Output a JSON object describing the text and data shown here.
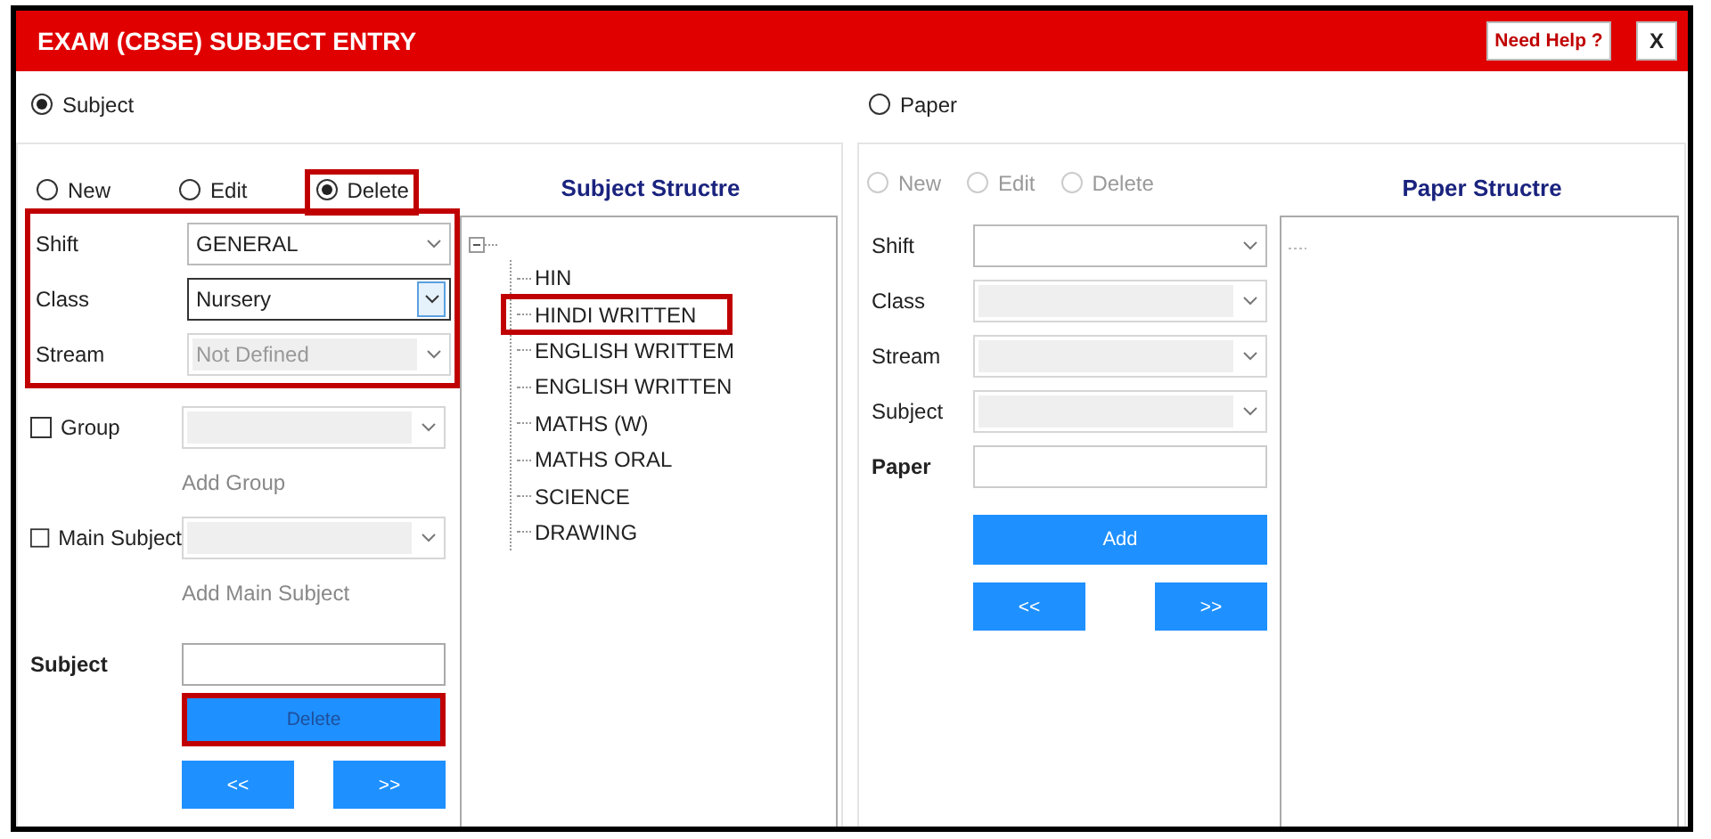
{
  "window": {
    "title": "EXAM (CBSE) SUBJECT ENTRY",
    "buttons": [
      "Need Help ?",
      "X"
    ]
  },
  "sections": [
    {
      "label": "Subject",
      "selected": true
    },
    {
      "label": "Paper",
      "selected": false
    }
  ],
  "subject_panel": {
    "modes": [
      {
        "label": "New",
        "selected": false,
        "disabled": false,
        "highlighted": false
      },
      {
        "label": "Edit",
        "selected": false,
        "disabled": false,
        "highlighted": false
      },
      {
        "label": "Delete",
        "selected": true,
        "disabled": false,
        "highlighted": true
      }
    ],
    "filters": {
      "highlighted": true,
      "fields": [
        {
          "label": "Shift",
          "value": "GENERAL",
          "disabled": false,
          "focused": false
        },
        {
          "label": "Class",
          "value": "Nursery",
          "disabled": false,
          "focused": true
        },
        {
          "label": "Stream",
          "value": "Not Defined",
          "disabled": true,
          "focused": false
        }
      ]
    },
    "options": [
      {
        "label": "Group",
        "checked": false,
        "disabled": true,
        "link": "Add Group"
      },
      {
        "label": "Main Subject",
        "checked": false,
        "disabled": true,
        "link": "Add Main Subject"
      }
    ],
    "name_field": {
      "label": "Subject"
    },
    "action": {
      "label": "Delete",
      "highlighted": true
    },
    "nav": [
      "<<",
      ">>"
    ],
    "structure": {
      "title": "Subject Structre",
      "expanded": true,
      "items": [
        {
          "label": "HIN",
          "highlighted": false
        },
        {
          "label": "HINDI WRITTEN",
          "highlighted": true
        },
        {
          "label": "ENGLISH WRITTEM",
          "highlighted": false
        },
        {
          "label": "ENGLISH WRITTEN",
          "highlighted": false
        },
        {
          "label": "MATHS (W)",
          "highlighted": false
        },
        {
          "label": "MATHS ORAL",
          "highlighted": false
        },
        {
          "label": "SCIENCE",
          "highlighted": false
        },
        {
          "label": "DRAWING",
          "highlighted": false
        }
      ]
    }
  },
  "paper_panel": {
    "modes": [
      {
        "label": "New",
        "selected": false,
        "disabled": true
      },
      {
        "label": "Edit",
        "selected": false,
        "disabled": true
      },
      {
        "label": "Delete",
        "selected": false,
        "disabled": true
      }
    ],
    "fields": [
      {
        "label": "Shift",
        "disabled": false
      },
      {
        "label": "Class",
        "disabled": true
      },
      {
        "label": "Stream",
        "disabled": true
      },
      {
        "label": "Subject",
        "disabled": true
      }
    ],
    "name_field": {
      "label": "Paper"
    },
    "action": {
      "label": "Add"
    },
    "nav": [
      "<<",
      ">>"
    ],
    "structure": {
      "title": "Paper Structre"
    }
  }
}
